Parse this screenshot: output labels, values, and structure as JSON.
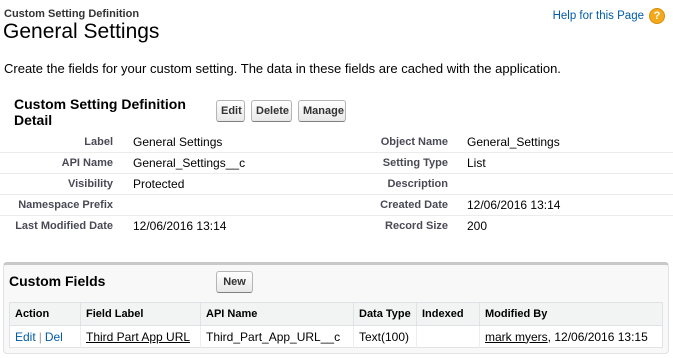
{
  "header": {
    "breadcrumb": "Custom Setting Definition",
    "title": "General Settings",
    "help_link": "Help for this Page",
    "help_icon": "question-icon"
  },
  "description": "Create the fields for your custom setting. The data in these fields are cached with the application.",
  "detail": {
    "title": "Custom Setting Definition Detail",
    "buttons": {
      "edit": "Edit",
      "delete": "Delete",
      "manage": "Manage"
    },
    "rows": [
      {
        "left_label": "Label",
        "left_value": "General Settings",
        "right_label": "Object Name",
        "right_value": "General_Settings"
      },
      {
        "left_label": "API Name",
        "left_value": "General_Settings__c",
        "right_label": "Setting Type",
        "right_value": "List"
      },
      {
        "left_label": "Visibility",
        "left_value": "Protected",
        "right_label": "Description",
        "right_value": ""
      },
      {
        "left_label": "Namespace Prefix",
        "left_value": "",
        "right_label": "Created Date",
        "right_value": "12/06/2016 13:14"
      },
      {
        "left_label": "Last Modified Date",
        "left_value": "12/06/2016 13:14",
        "right_label": "Record Size",
        "right_value": "200"
      }
    ]
  },
  "custom_fields": {
    "title": "Custom Fields",
    "new_button": "New",
    "columns": [
      "Action",
      "Field Label",
      "API Name",
      "Data Type",
      "Indexed",
      "Modified By"
    ],
    "rows": [
      {
        "action_edit": "Edit",
        "action_sep": "|",
        "action_del": "Del",
        "field_label": "Third Part App URL",
        "api_name": "Third_Part_App_URL__c",
        "data_type": "Text(100)",
        "indexed": "",
        "modified_by_user": "mark myers",
        "modified_by_date": ", 12/06/2016 13:15"
      }
    ]
  },
  "colors": {
    "link": "#015ba7",
    "help_icon": "#f3a91a"
  }
}
